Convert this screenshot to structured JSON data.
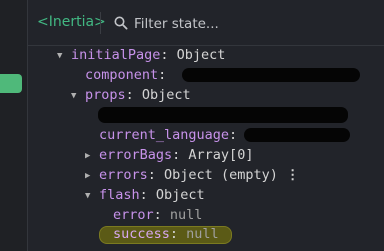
{
  "header": {
    "title": "<Inertia>",
    "search_placeholder": "Filter state..."
  },
  "tree": {
    "initialPage": {
      "key": "initialPage",
      "sep": ": ",
      "value": "Object"
    },
    "component": {
      "key": "component",
      "sep": ":"
    },
    "props": {
      "key": "props",
      "sep": ": ",
      "value": "Object"
    },
    "current_language": {
      "key": "current_language",
      "sep": ":"
    },
    "errorBags": {
      "key": "errorBags",
      "sep": ": ",
      "value": "Array[0]"
    },
    "errors": {
      "key": "errors",
      "sep": ": ",
      "value": "Object (empty)",
      "more": "⋮"
    },
    "flash": {
      "key": "flash",
      "sep": ": ",
      "value": "Object"
    },
    "error": {
      "key": "error",
      "sep": ": ",
      "value": "null"
    },
    "success": {
      "key": "success",
      "sep": ": ",
      "value": "null"
    }
  },
  "colors": {
    "accent": "#42b883",
    "key": "#c792ea",
    "highlight": "#5b5a16",
    "background": "#22242a"
  }
}
